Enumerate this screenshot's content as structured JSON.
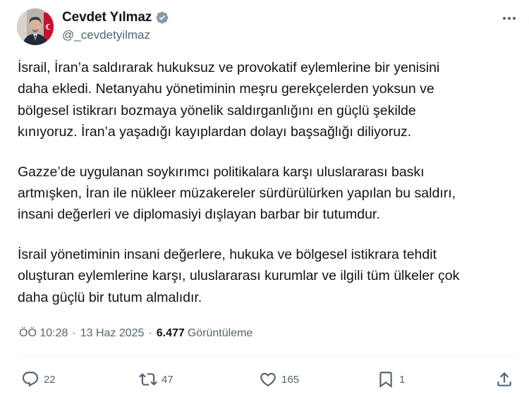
{
  "author": {
    "display_name": "Cevdet Yılmaz",
    "handle": "@_cevdetyilmaz",
    "verified_badge_icon": "verified-badge-icon",
    "avatar_icon": "profile-photo"
  },
  "post": {
    "paragraphs": [
      "İsrail, İran’a saldırarak hukuksuz ve provokatif eylemlerine bir yenisini\ndaha ekledi. Netanyahu yönetiminin meşru gerekçelerden yoksun ve\nbölgesel istikrarı bozmaya yönelik saldırganlığını en güçlü şekilde\nkınıyoruz. İran’a yaşadığı kayıplardan dolayı başsağlığı diliyoruz.",
      "Gazze’de uygulanan soykırımcı politikalara karşı uluslararası baskı\nartmışken, İran ile nükleer müzakereler sürdürülürken yapılan bu saldırı,\ninsani değerleri ve diplomasiyi dışlayan barbar bir tutumdur.",
      "İsrail yönetiminin insani değerlere, hukuka ve bölgesel istikrara tehdit\noluşturan eylemlerine karşı, uluslararası kurumlar ve ilgili tüm ülkeler çok\ndaha güçlü bir tutum almalıdır."
    ],
    "time": "ÖÖ 10:28",
    "separator": "·",
    "date": "13 Haz 2025",
    "views_count": "6.477",
    "views_label": "Görüntüleme"
  },
  "actions": {
    "replies": "22",
    "reposts": "47",
    "likes": "165",
    "bookmarks": "1"
  },
  "colors": {
    "text": "#0f1419",
    "muted": "#536471",
    "verified_blue": "#829aab",
    "divider": "#eff3f4"
  }
}
